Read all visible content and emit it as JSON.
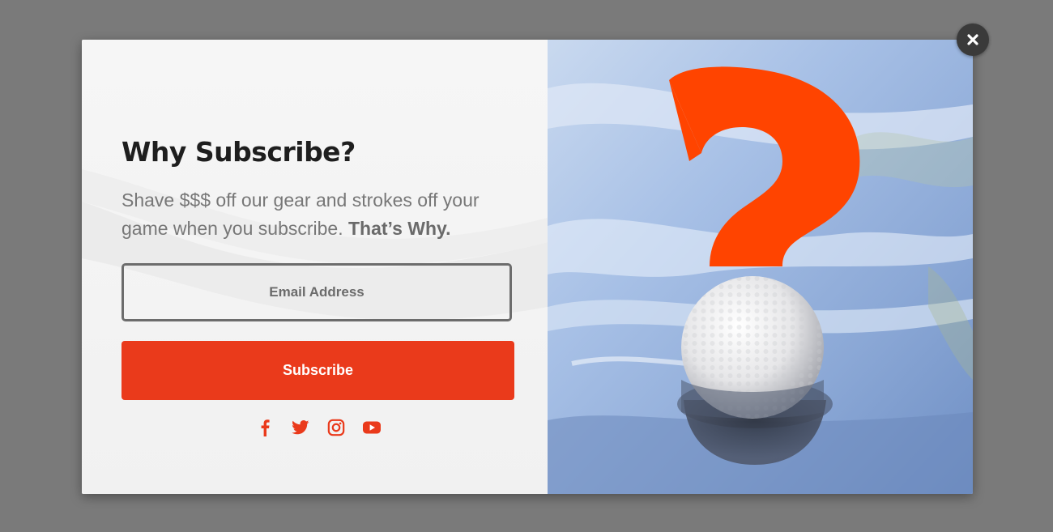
{
  "popup": {
    "title": "Why Subscribe?",
    "description": "Shave $$$ off our gear and strokes off your game when you subscribe. ",
    "description_emphasis": "That’s Why.",
    "email_placeholder": "Email Address",
    "subscribe_label": "Subscribe",
    "accent_color": "#ea3a1b"
  },
  "social_icons": [
    "facebook-icon",
    "twitter-icon",
    "instagram-icon",
    "youtube-icon"
  ],
  "close_icon": "close-icon",
  "image": {
    "subject": "golf ball in water with orange question mark"
  }
}
